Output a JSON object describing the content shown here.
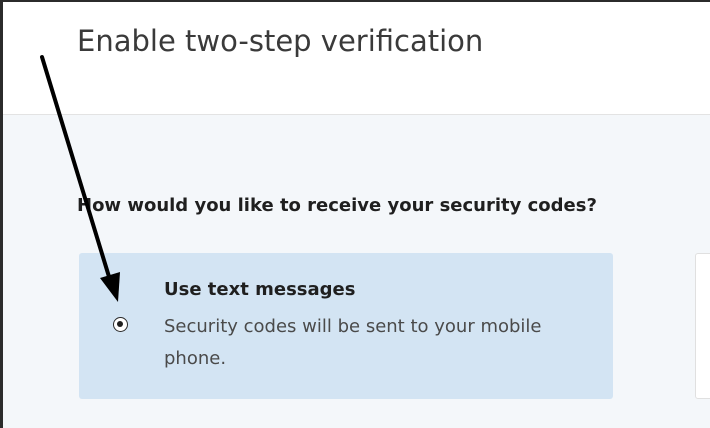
{
  "dialog": {
    "title": "Enable two-step verification",
    "question": "How would you like to receive your security codes?"
  },
  "options": [
    {
      "title": "Use text messages",
      "description": "Security codes will be sent to your mobile phone.",
      "selected": true
    }
  ],
  "colors": {
    "selected_card_bg": "#d3e4f3",
    "body_bg": "#f4f7fa",
    "annotation_arrow": "#000000"
  }
}
